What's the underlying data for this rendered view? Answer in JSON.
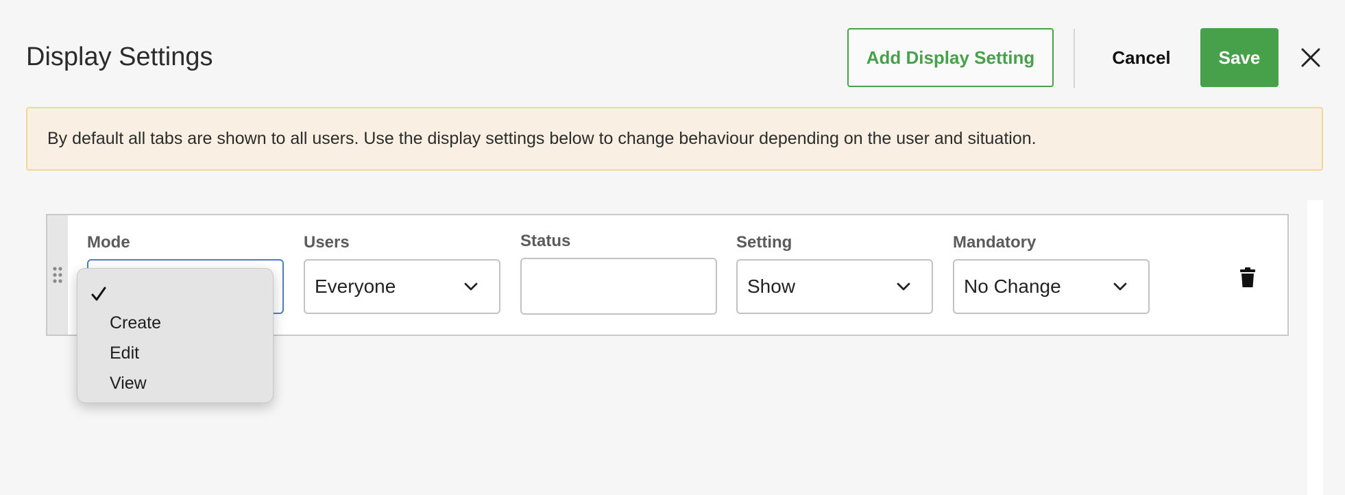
{
  "header": {
    "title": "Display Settings",
    "add_button": "Add Display Setting",
    "cancel_button": "Cancel",
    "save_button": "Save"
  },
  "banner": {
    "text": "By default all tabs are shown to all users. Use the display settings below to change behaviour depending on the user and situation."
  },
  "row": {
    "mode": {
      "label": "Mode",
      "value": ""
    },
    "users": {
      "label": "Users",
      "value": "Everyone"
    },
    "status": {
      "label": "Status",
      "value": ""
    },
    "setting": {
      "label": "Setting",
      "value": "Show"
    },
    "mandatory": {
      "label": "Mandatory",
      "value": "No Change"
    }
  },
  "mode_dropdown": {
    "options": [
      "",
      "Create",
      "Edit",
      "View"
    ],
    "selected_index": 0
  },
  "colors": {
    "accent_green": "#47a14a",
    "banner_bg": "#f9efe2",
    "banner_border": "#f2d98e",
    "focus_border": "#4a7fbf"
  },
  "icons": {
    "close": "close-icon",
    "drag": "drag-handle-icon",
    "chevron": "chevron-down-icon",
    "delete": "trash-icon",
    "check": "checkmark-icon"
  }
}
